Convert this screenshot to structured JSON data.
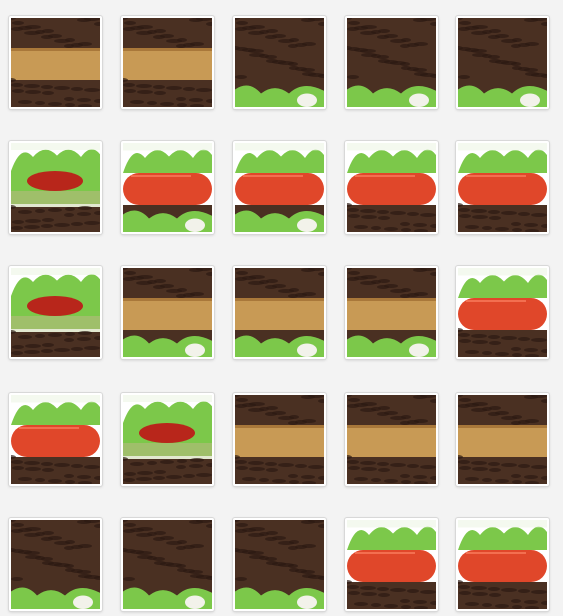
{
  "puzzle": {
    "tiles": [
      {
        "id": "r1c1",
        "layers": [
          "patty",
          "bun-tan",
          "patty"
        ]
      },
      {
        "id": "r1c2",
        "layers": [
          "patty",
          "bun-tan",
          "patty"
        ]
      },
      {
        "id": "r1c3",
        "layers": [
          "patty",
          "patty",
          "lettuce-bottom"
        ]
      },
      {
        "id": "r1c4",
        "layers": [
          "patty",
          "patty",
          "lettuce-bottom"
        ]
      },
      {
        "id": "r1c5",
        "layers": [
          "patty",
          "patty",
          "lettuce-bottom"
        ]
      },
      {
        "id": "r2c1",
        "layers": [
          "lettuce",
          "ketchup",
          "cucumber",
          "patty"
        ]
      },
      {
        "id": "r2c2",
        "layers": [
          "lettuce",
          "tomato",
          "lettuce-bottom"
        ]
      },
      {
        "id": "r2c3",
        "layers": [
          "lettuce",
          "tomato",
          "lettuce-bottom"
        ]
      },
      {
        "id": "r2c4",
        "layers": [
          "lettuce",
          "tomato",
          "patty"
        ]
      },
      {
        "id": "r2c5",
        "layers": [
          "lettuce",
          "tomato",
          "patty"
        ]
      },
      {
        "id": "r3c1",
        "layers": [
          "lettuce",
          "ketchup",
          "cucumber",
          "patty"
        ]
      },
      {
        "id": "r3c2",
        "layers": [
          "patty",
          "bun-tan",
          "lettuce-bottom"
        ]
      },
      {
        "id": "r3c3",
        "layers": [
          "patty",
          "bun-tan",
          "lettuce-bottom"
        ]
      },
      {
        "id": "r3c4",
        "layers": [
          "patty",
          "bun-tan",
          "lettuce-bottom"
        ]
      },
      {
        "id": "r3c5",
        "layers": [
          "lettuce",
          "tomato",
          "patty"
        ]
      },
      {
        "id": "r4c1",
        "layers": [
          "lettuce",
          "tomato",
          "patty"
        ]
      },
      {
        "id": "r4c2",
        "layers": [
          "lettuce",
          "ketchup",
          "cucumber",
          "patty"
        ]
      },
      {
        "id": "r4c3",
        "layers": [
          "patty",
          "bun-tan",
          "patty"
        ]
      },
      {
        "id": "r4c4",
        "layers": [
          "patty",
          "bun-tan",
          "patty"
        ]
      },
      {
        "id": "r4c5",
        "layers": [
          "patty",
          "bun-tan",
          "patty"
        ]
      },
      {
        "id": "r5c1",
        "layers": [
          "patty",
          "patty",
          "lettuce-bottom"
        ]
      },
      {
        "id": "r5c2",
        "layers": [
          "patty",
          "patty",
          "lettuce-bottom"
        ]
      },
      {
        "id": "r5c3",
        "layers": [
          "patty",
          "patty",
          "lettuce-bottom"
        ]
      },
      {
        "id": "r5c4",
        "layers": [
          "lettuce",
          "tomato",
          "patty"
        ]
      },
      {
        "id": "r5c5",
        "layers": [
          "lettuce",
          "tomato",
          "patty"
        ]
      }
    ]
  },
  "colors": {
    "patty": "#4a3022",
    "patty_dark": "#2c1a12",
    "bun": "#c89a55",
    "lettuce": "#7cc84a",
    "tomato": "#e0472a",
    "ketchup": "#b8261b",
    "cucumber": "#9fbf6a",
    "mayo": "#f2f2ea"
  }
}
